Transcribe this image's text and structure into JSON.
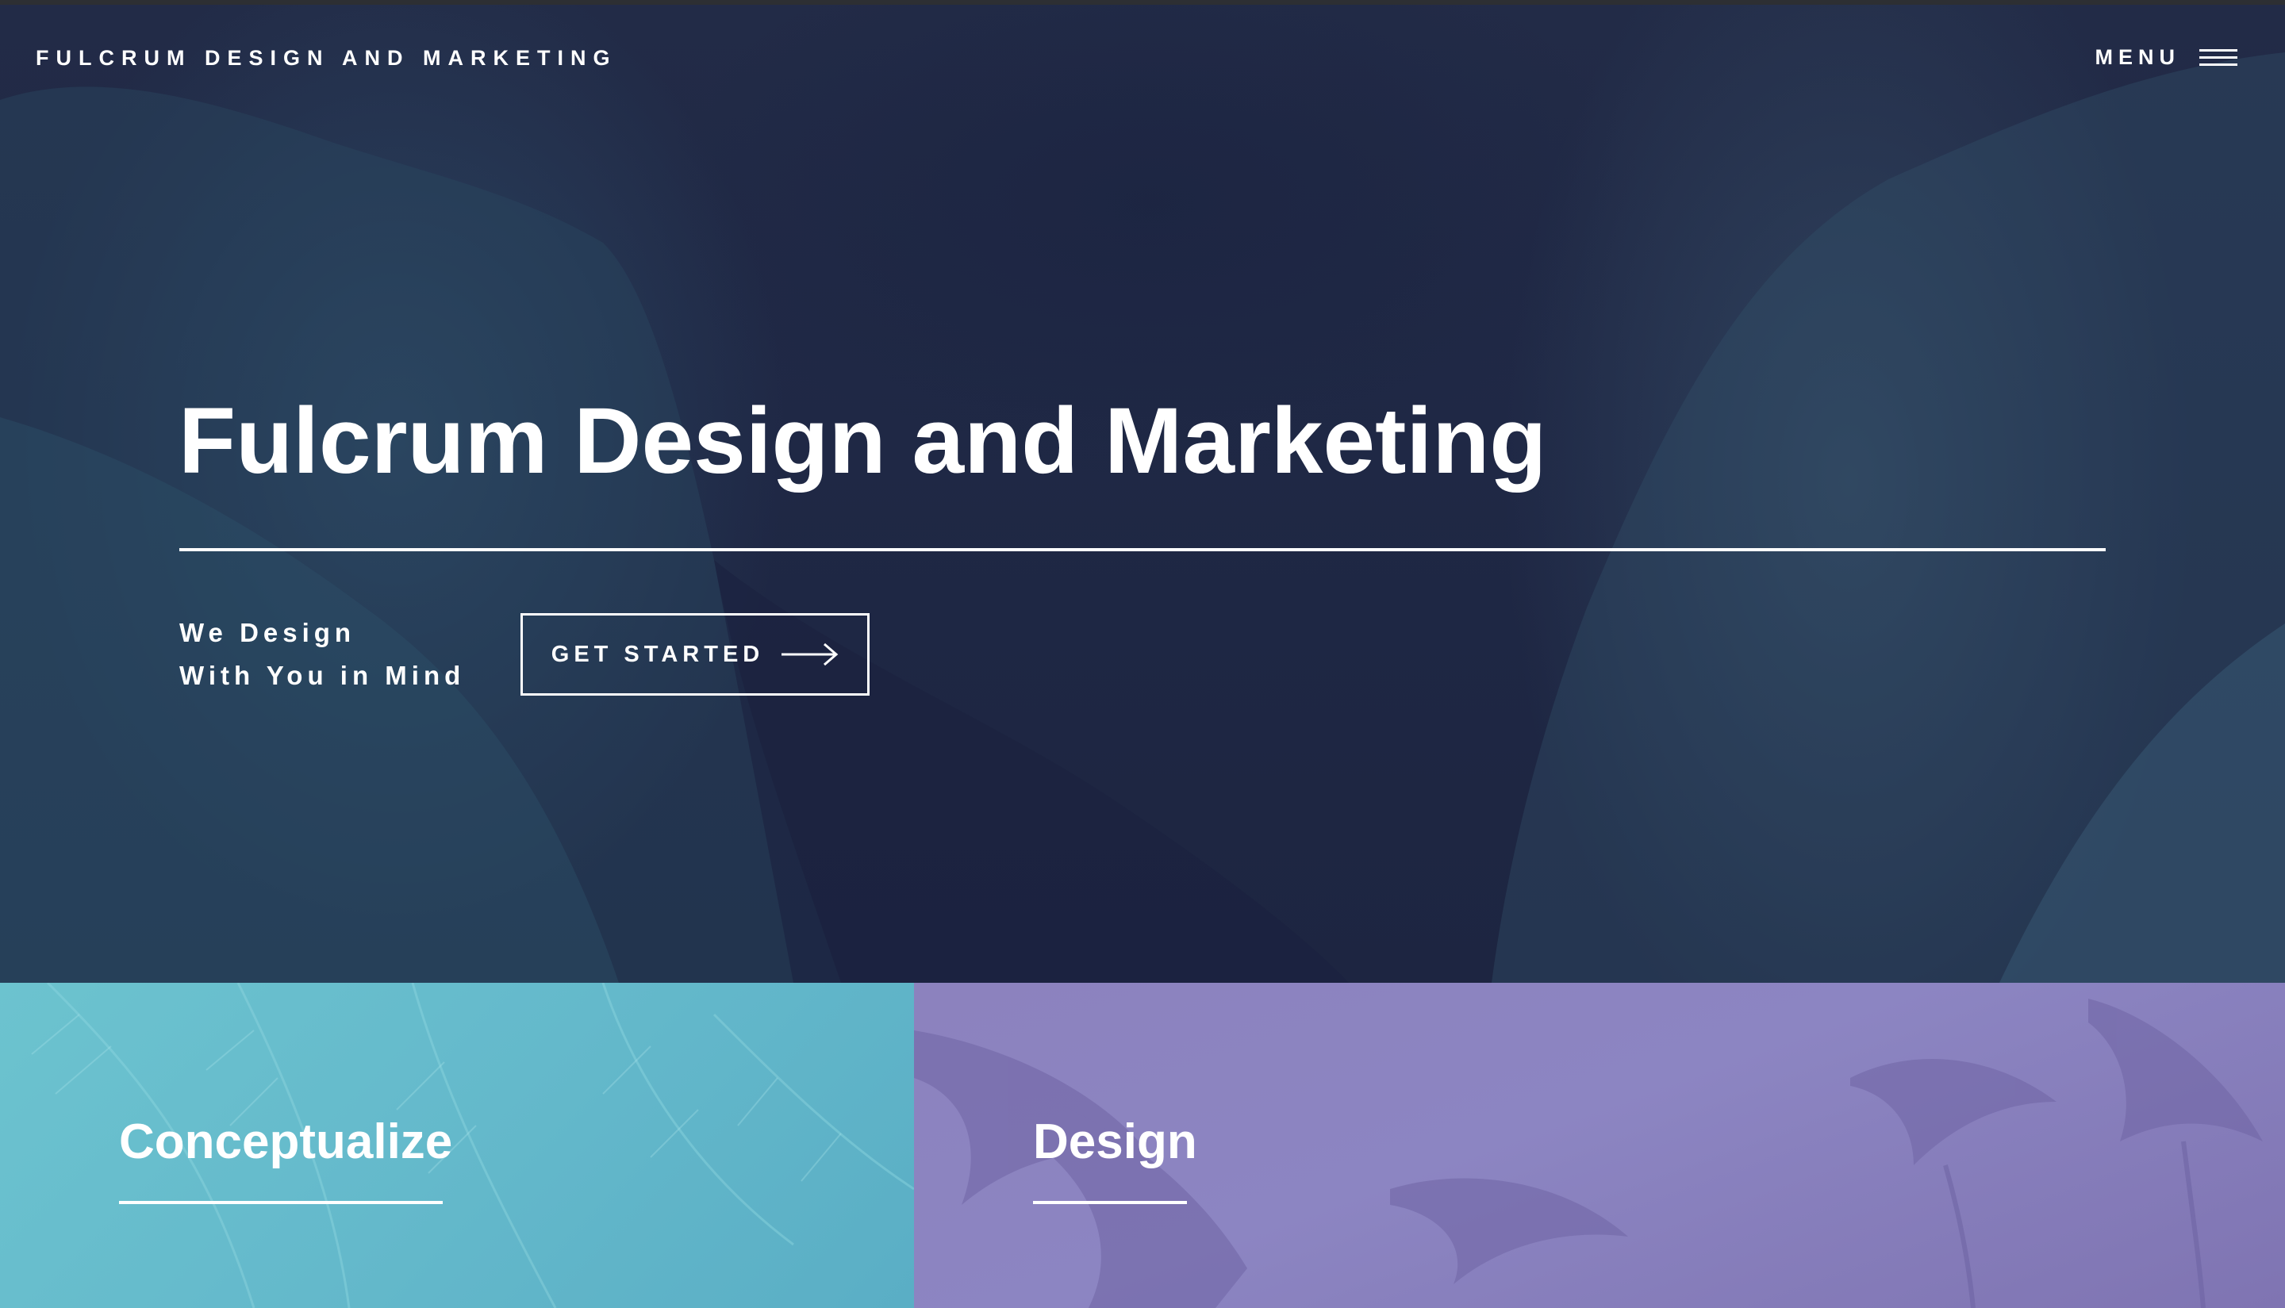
{
  "header": {
    "brand": "FULCRUM DESIGN AND MARKETING",
    "menu_label": "MENU",
    "menu_icon": "hamburger-icon"
  },
  "hero": {
    "title": "Fulcrum Design and Marketing",
    "tagline_line1": "We Design",
    "tagline_line2": "With You in Mind",
    "cta_label": "GET STARTED",
    "cta_icon": "arrow-right-icon"
  },
  "panels": [
    {
      "title": "Conceptualize",
      "color": "#67bccc"
    },
    {
      "title": "Design",
      "color": "#8a80bd"
    }
  ],
  "colors": {
    "hero_bg": "#1f2743",
    "text": "#ffffff"
  }
}
